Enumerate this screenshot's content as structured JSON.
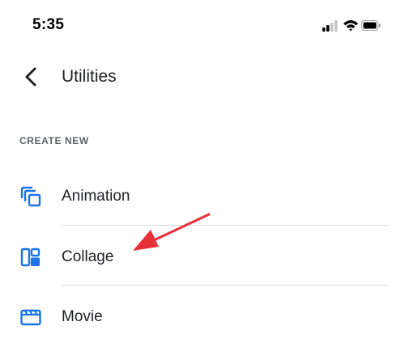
{
  "status_bar": {
    "time": "5:35"
  },
  "header": {
    "title": "Utilities"
  },
  "section": {
    "heading": "CREATE NEW"
  },
  "items": [
    {
      "label": "Animation",
      "icon": "animation-icon"
    },
    {
      "label": "Collage",
      "icon": "collage-icon"
    },
    {
      "label": "Movie",
      "icon": "movie-icon"
    }
  ],
  "colors": {
    "accent": "#1a73e8",
    "annotation_arrow": "#e8303a"
  }
}
